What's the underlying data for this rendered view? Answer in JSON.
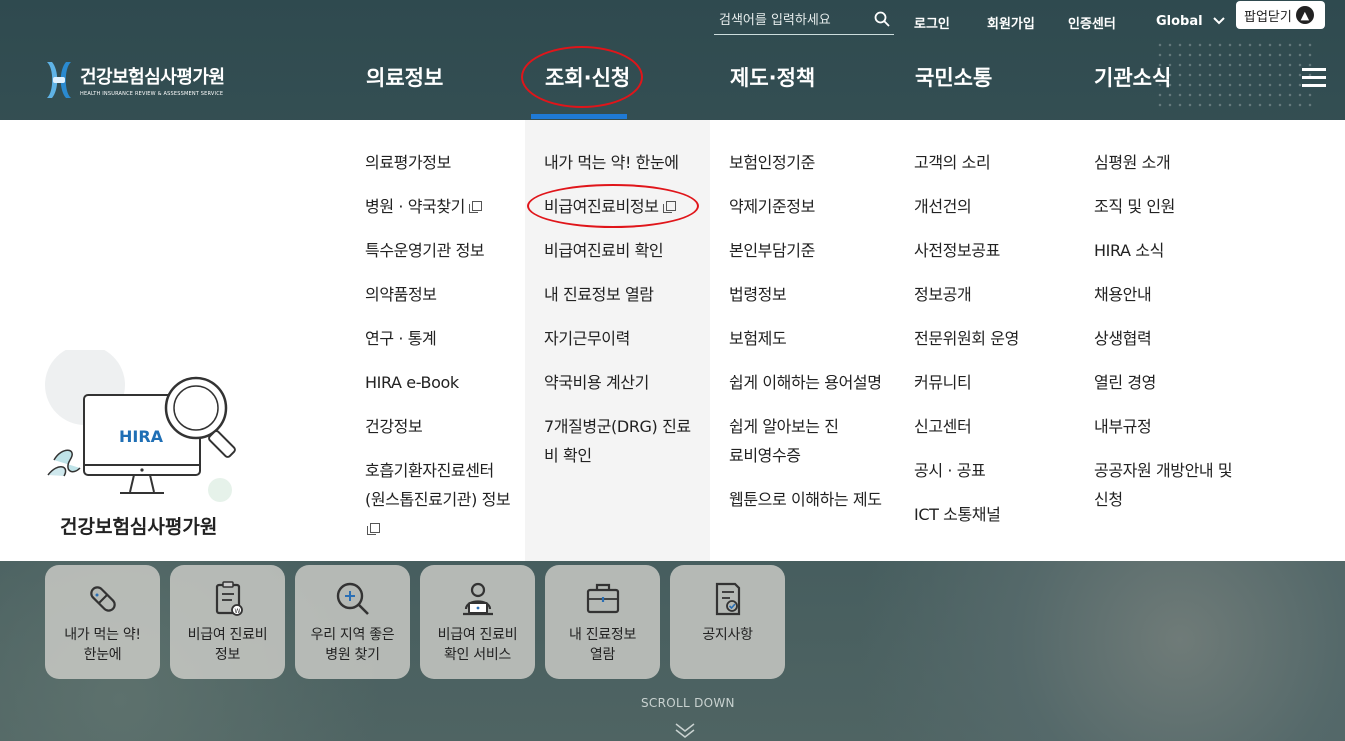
{
  "header": {
    "logo_title": "건강보험심사평가원",
    "logo_subtitle": "HEALTH INSURANCE REVIEW & ASSESSMENT SERVICE",
    "search_placeholder": "검색어를 입력하세요",
    "util_links": [
      "로그인",
      "회원가입",
      "인증센터",
      "Global"
    ],
    "popup_close": "팝업닫기",
    "nav": [
      "의료정보",
      "조회·신청",
      "제도·정책",
      "국민소통",
      "기관소식"
    ],
    "active_nav": "조회·신청",
    "accent_color": "#1f7ad6"
  },
  "promo": {
    "badge": "HIRA",
    "title": "건강보험심사평가원"
  },
  "menu_columns": [
    [
      {
        "label": "의료평가정보",
        "external": false
      },
      {
        "label": "병원 · 약국찾기",
        "external": true
      },
      {
        "label": "특수운영기관 정보",
        "external": false
      },
      {
        "label": "의약품정보",
        "external": false
      },
      {
        "label": "연구 · 통계",
        "external": false
      },
      {
        "label": "HIRA e-Book",
        "external": false
      },
      {
        "label": "건강정보",
        "external": false
      },
      {
        "label": "호흡기환자진료센터 (원스톱진료기관) 정보",
        "external": true
      }
    ],
    [
      {
        "label": "내가 먹는 약! 한눈에",
        "external": false
      },
      {
        "label": "비급여진료비정보",
        "external": true
      },
      {
        "label": "비급여진료비 확인",
        "external": false
      },
      {
        "label": "내 진료정보 열람",
        "external": false
      },
      {
        "label": "자기근무이력",
        "external": false
      },
      {
        "label": "약국비용 계산기",
        "external": false
      },
      {
        "label": "7개질병군(DRG) 진료비 확인",
        "external": false
      }
    ],
    [
      {
        "label": "보험인정기준",
        "external": false
      },
      {
        "label": "약제기준정보",
        "external": false
      },
      {
        "label": "본인부담기준",
        "external": false
      },
      {
        "label": "법령정보",
        "external": false
      },
      {
        "label": "보험제도",
        "external": false
      },
      {
        "label": "쉽게 이해하는 용어설명",
        "external": false
      },
      {
        "label": "쉽게 알아보는 진료비영수증",
        "external": false
      },
      {
        "label": "웹툰으로 이해하는 제도",
        "external": false
      }
    ],
    [
      {
        "label": "고객의 소리",
        "external": false
      },
      {
        "label": "개선건의",
        "external": false
      },
      {
        "label": "사전정보공표",
        "external": false
      },
      {
        "label": "정보공개",
        "external": false
      },
      {
        "label": "전문위원회 운영",
        "external": false
      },
      {
        "label": "커뮤니티",
        "external": false
      },
      {
        "label": "신고센터",
        "external": false
      },
      {
        "label": "공시 · 공표",
        "external": false
      },
      {
        "label": "ICT 소통채널",
        "external": false
      }
    ],
    [
      {
        "label": "심평원 소개",
        "external": false
      },
      {
        "label": "조직 및 인원",
        "external": false
      },
      {
        "label": "HIRA 소식",
        "external": false
      },
      {
        "label": "채용안내",
        "external": false
      },
      {
        "label": "상생협력",
        "external": false
      },
      {
        "label": "열린 경영",
        "external": false
      },
      {
        "label": "내부규정",
        "external": false
      },
      {
        "label": "공공자원 개방안내 및 신청",
        "external": false
      }
    ]
  ],
  "quick_menu": [
    {
      "label": "내가 먹는 약!\n한눈에",
      "icon": "pill-icon"
    },
    {
      "label": "비급여 진료비\n정보",
      "icon": "document-icon"
    },
    {
      "label": "우리 지역 좋은\n병원 찾기",
      "icon": "search-plus-icon"
    },
    {
      "label": "비급여 진료비\n확인 서비스",
      "icon": "person-laptop-icon"
    },
    {
      "label": "내 진료정보\n열람",
      "icon": "briefcase-icon"
    },
    {
      "label": "공지사항",
      "icon": "notice-icon"
    }
  ],
  "scroll_label": "SCROLL DOWN",
  "annotation_color": "#e0151a"
}
